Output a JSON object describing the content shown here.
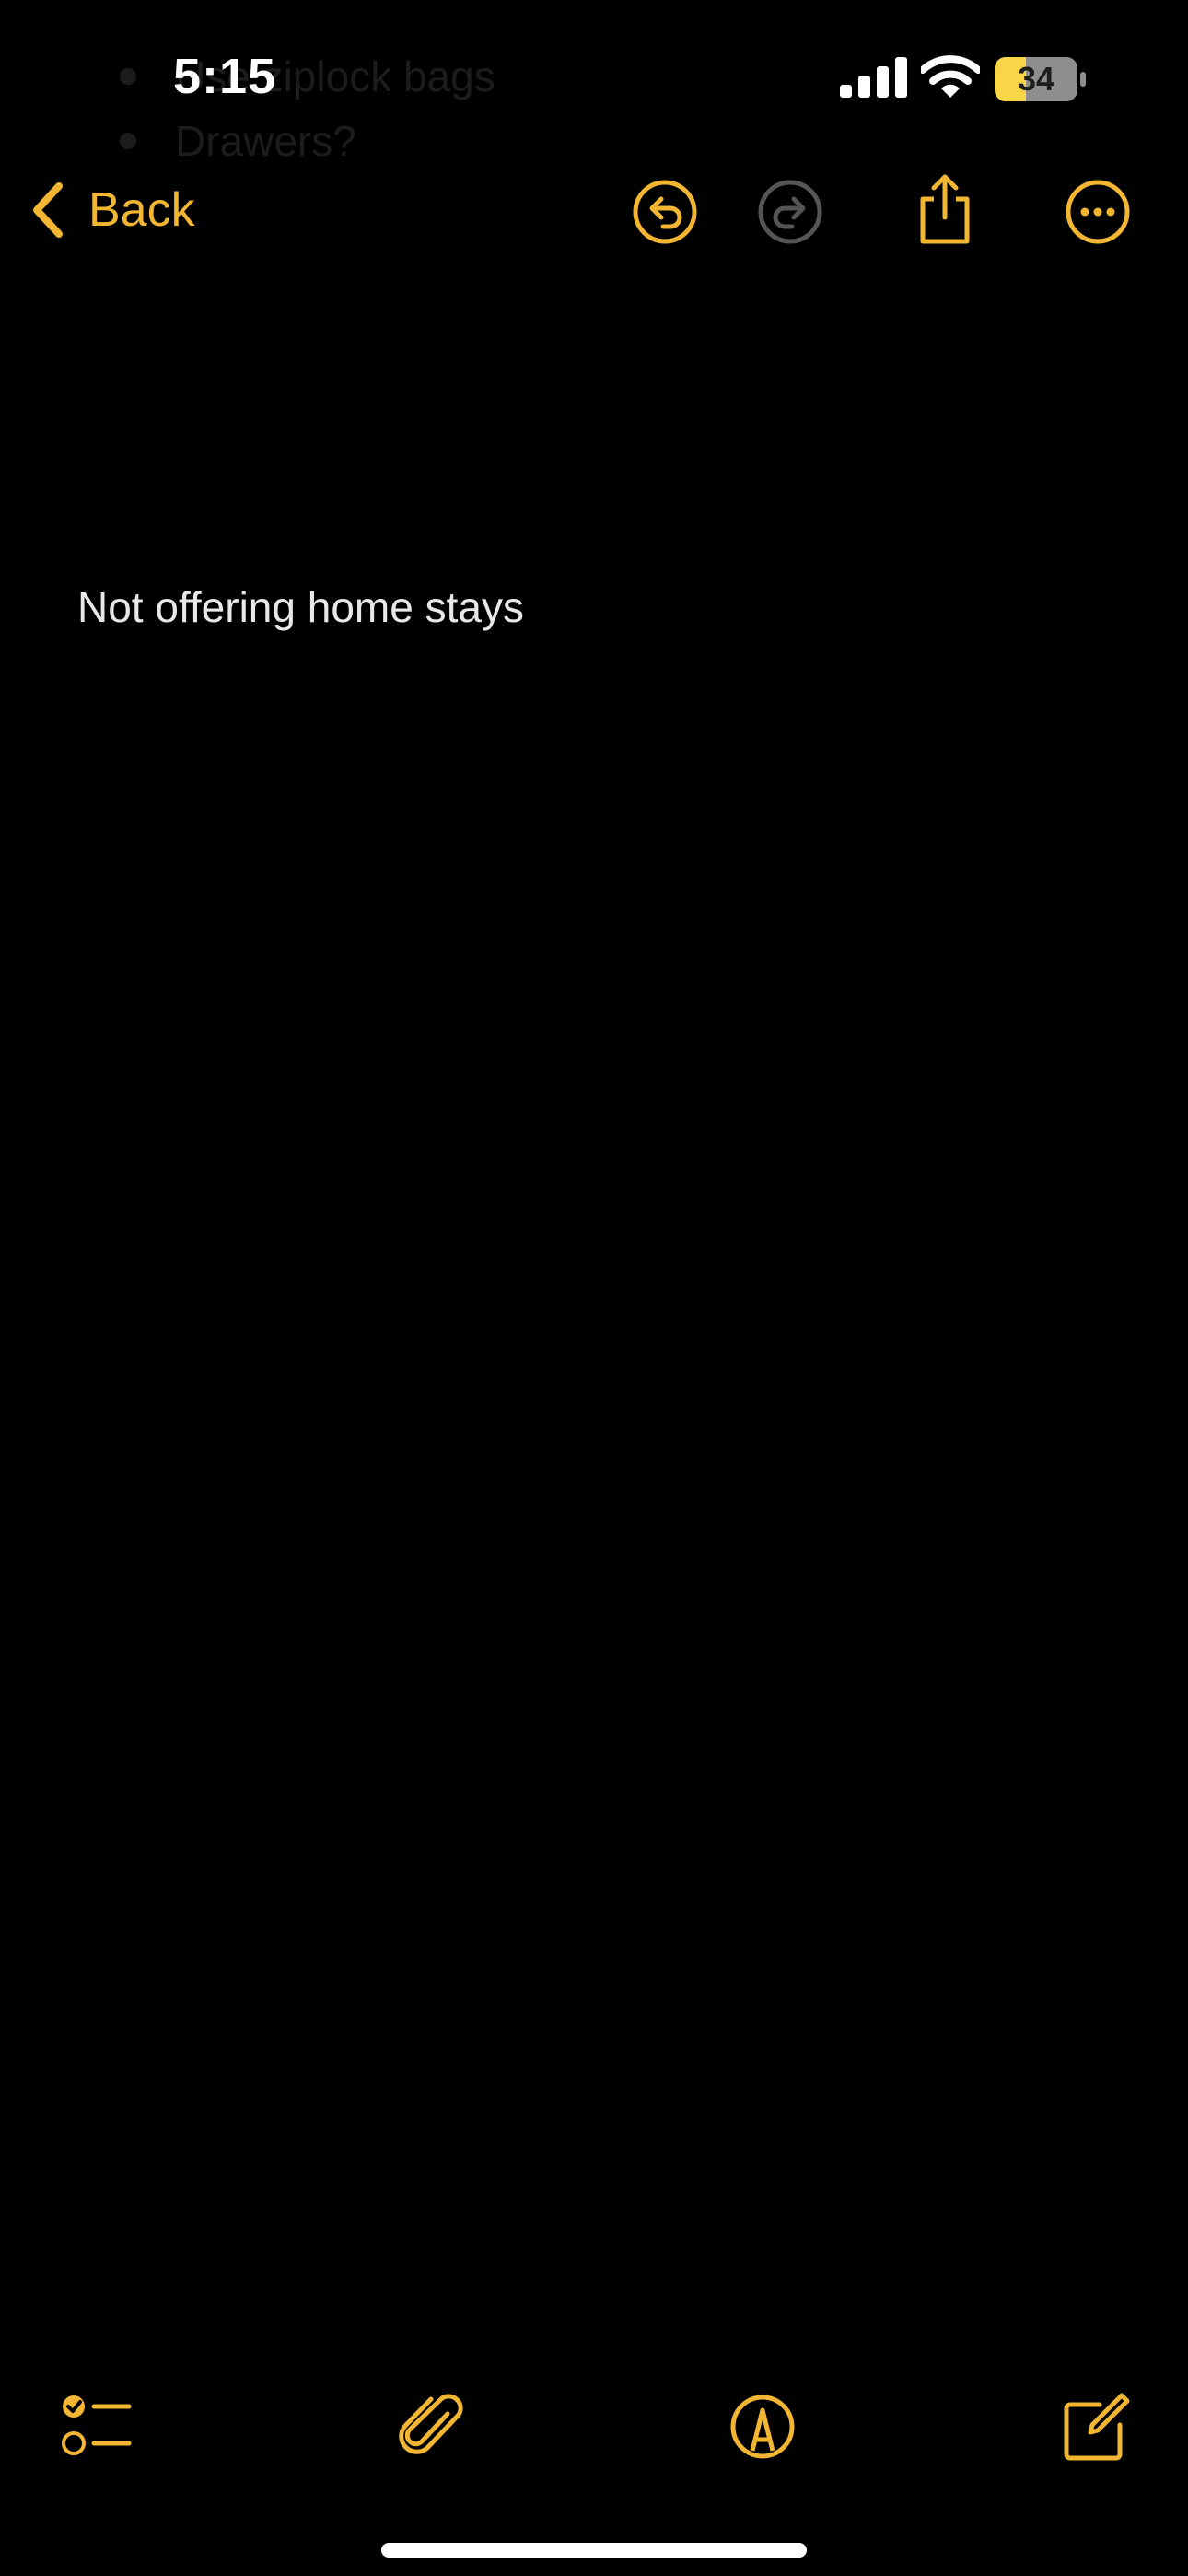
{
  "background_ghost": {
    "lines": [
      "Use ziplock bags",
      "Drawers?"
    ]
  },
  "status_bar": {
    "time": "5:15",
    "battery_level": "34",
    "signal_icon": "cellular-signal-icon",
    "wifi_icon": "wifi-icon",
    "battery_icon": "battery-icon"
  },
  "nav": {
    "back_label": "Back",
    "back_icon": "chevron-left-icon",
    "undo_icon": "undo-icon",
    "redo_icon": "redo-icon",
    "share_icon": "share-icon",
    "more_icon": "more-icon"
  },
  "note": {
    "body": "Not offering home stays"
  },
  "toolbar": {
    "checklist_icon": "checklist-icon",
    "attachment_icon": "paperclip-icon",
    "markup_icon": "markup-pen-icon",
    "compose_icon": "compose-icon"
  },
  "colors": {
    "background": "#000000",
    "accent": "#F2B632",
    "disabled": "#555555",
    "text": "#E8E8E8",
    "battery_fill": "#F9D548",
    "battery_shell": "#8E8E8E"
  }
}
